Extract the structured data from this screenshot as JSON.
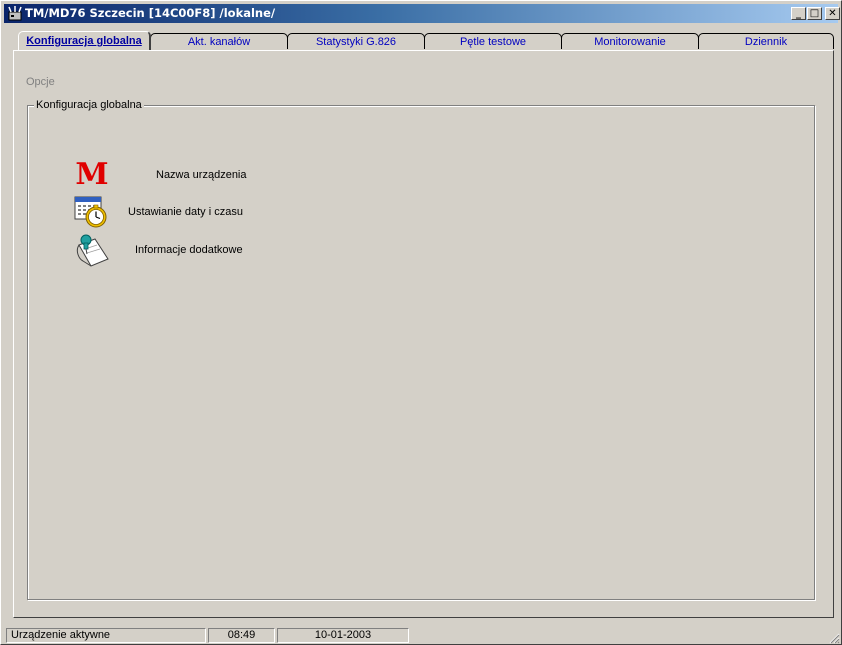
{
  "window": {
    "title": "TM/MD76 Szczecin [14C00F8] /lokalne/",
    "controls": {
      "minimize": "_",
      "maximize": "□",
      "close": "✕"
    }
  },
  "tabs": [
    {
      "label": "Konfiguracja globalna",
      "active": true
    },
    {
      "label": "Akt. kanałów"
    },
    {
      "label": "Statystyki G.826"
    },
    {
      "label": "Pętle testowe"
    },
    {
      "label": "Monitorowanie"
    },
    {
      "label": "Dziennik"
    }
  ],
  "content": {
    "section_label": "Opcje",
    "group_title": "Konfiguracja globalna",
    "options": [
      {
        "icon": "red-m-icon",
        "glyph": "M",
        "label": "Nazwa urządzenia"
      },
      {
        "icon": "calendar-clock-icon",
        "label": "Ustawianie daty i czasu"
      },
      {
        "icon": "document-pin-icon",
        "label": "Informacje dodatkowe"
      }
    ]
  },
  "status": {
    "state": "Urządzenie aktywne",
    "time": "08:49",
    "date": "10-01-2003"
  },
  "colors": {
    "title_start": "#0a246a",
    "title_end": "#a6caf0",
    "tab_text": "#0000c0",
    "m_icon": "#e00000"
  }
}
